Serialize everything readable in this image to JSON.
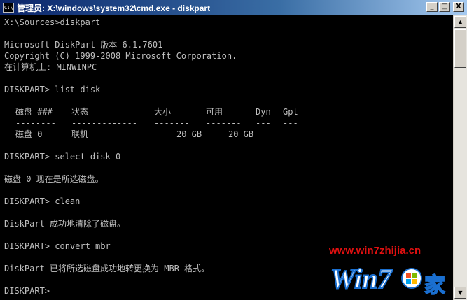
{
  "window": {
    "title": "管理员: X:\\windows\\system32\\cmd.exe - diskpart",
    "icon": "C:\\",
    "buttons": {
      "minimize": "_",
      "maximize": "□",
      "close": "X"
    }
  },
  "console": {
    "lines": [
      "X:\\Sources>diskpart",
      "",
      "Microsoft DiskPart 版本 6.1.7601",
      "Copyright (C) 1999-2008 Microsoft Corporation.",
      "在计算机上: MINWINPC",
      "",
      "DISKPART> list disk",
      "",
      "",
      "",
      "",
      "",
      "",
      "DISKPART> select disk 0",
      "",
      "磁盘 0 现在是所选磁盘。",
      "",
      "DISKPART> clean",
      "",
      "DiskPart 成功地清除了磁盘。",
      "",
      "DISKPART> convert mbr",
      "",
      "DiskPart 已将所选磁盘成功地转更换为 MBR 格式。",
      "",
      "DISKPART>"
    ],
    "disk_table": {
      "headers": [
        "磁盘 ###",
        "状态",
        "大小",
        "可用",
        "Dyn",
        "Gpt"
      ],
      "separators": [
        "--------",
        "-------------",
        "-------",
        "-------",
        "---",
        "---"
      ],
      "rows": [
        [
          "磁盘 0",
          "联机",
          "20 GB",
          "20 GB",
          "",
          ""
        ]
      ]
    }
  },
  "watermark": {
    "url": "www.win7zhijia.cn",
    "logo_text": "Win7",
    "logo_suffix": "家"
  },
  "colors": {
    "console_bg": "#000000",
    "console_text": "#c0c0c0",
    "titlebar_start": "#0a246a",
    "titlebar_end": "#a6caf0",
    "watermark_red": "#e01010",
    "watermark_blue": "#1a6fd0"
  }
}
